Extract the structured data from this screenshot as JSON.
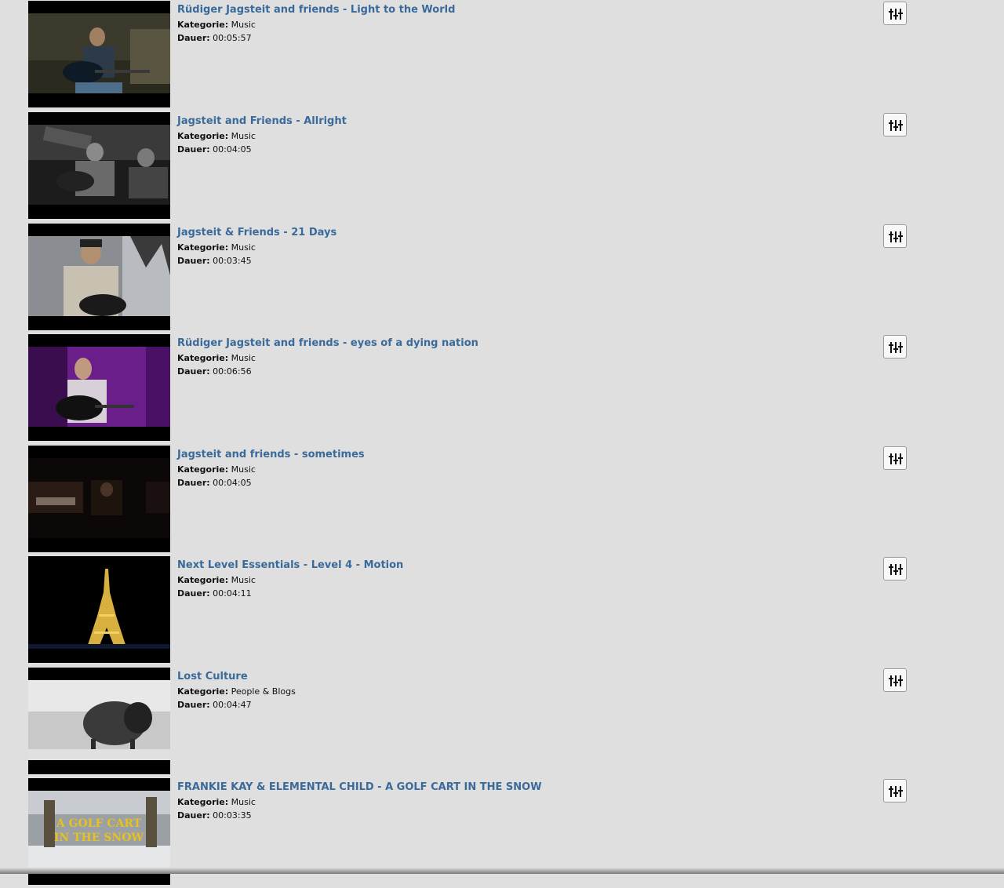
{
  "labels": {
    "category": "Kategorie:",
    "duration": "Dauer:"
  },
  "videos": [
    {
      "title": "Rüdiger Jagsteit and friends - Light to the World",
      "category": "Music",
      "duration": "00:05:57"
    },
    {
      "title": "Jagsteit and Friends - Allright",
      "category": "Music",
      "duration": "00:04:05"
    },
    {
      "title": "Jagsteit & Friends - 21 Days",
      "category": "Music",
      "duration": "00:03:45"
    },
    {
      "title": "Rüdiger Jagsteit and friends - eyes of a dying nation",
      "category": "Music",
      "duration": "00:06:56"
    },
    {
      "title": "Jagsteit and friends - sometimes",
      "category": "Music",
      "duration": "00:04:05"
    },
    {
      "title": "Next Level Essentials - Level 4 - Motion",
      "category": "Music",
      "duration": "00:04:11"
    },
    {
      "title": "Lost Culture",
      "category": "People & Blogs",
      "duration": "00:04:47"
    },
    {
      "title": "FRANKIE KAY & ELEMENTAL CHILD - A GOLF CART IN THE SNOW",
      "category": "Music",
      "duration": "00:03:35",
      "thumb_text": [
        "A GOLF CART",
        "IN THE SNOW"
      ]
    }
  ],
  "icons": {
    "options": "sliders-icon"
  },
  "colors": {
    "title_link": "#3a6a9a",
    "background": "#dfdfdf"
  }
}
